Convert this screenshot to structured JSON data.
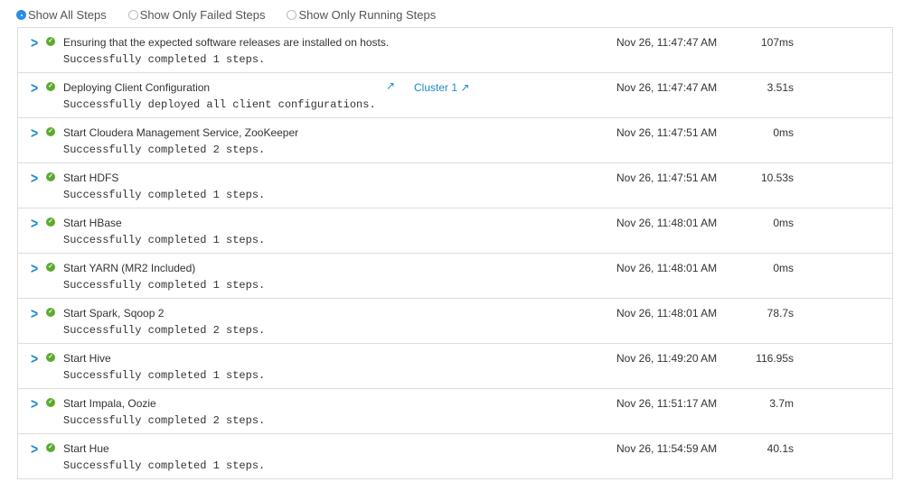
{
  "filters": [
    {
      "label": "Show All Steps",
      "selected": true
    },
    {
      "label": "Show Only Failed Steps",
      "selected": false
    },
    {
      "label": "Show Only Running Steps",
      "selected": false
    }
  ],
  "colors": {
    "accent": "#1a8bd1",
    "success": "#5aab2e"
  },
  "steps": [
    {
      "title": "Ensuring that the expected software releases are installed on hosts.",
      "detail": "Successfully completed 1 steps.",
      "time": "Nov 26, 11:47:47 AM",
      "duration": "107ms"
    },
    {
      "title": "Deploying Client Configuration",
      "detail": "Successfully deployed all client configurations.",
      "time": "Nov 26, 11:47:47 AM",
      "duration": "3.51s",
      "link": "Cluster 1"
    },
    {
      "title": "Start Cloudera Management Service, ZooKeeper",
      "detail": "Successfully completed 2 steps.",
      "time": "Nov 26, 11:47:51 AM",
      "duration": "0ms"
    },
    {
      "title": "Start HDFS",
      "detail": "Successfully completed 1 steps.",
      "time": "Nov 26, 11:47:51 AM",
      "duration": "10.53s"
    },
    {
      "title": "Start HBase",
      "detail": "Successfully completed 1 steps.",
      "time": "Nov 26, 11:48:01 AM",
      "duration": "0ms"
    },
    {
      "title": "Start YARN (MR2 Included)",
      "detail": "Successfully completed 1 steps.",
      "time": "Nov 26, 11:48:01 AM",
      "duration": "0ms"
    },
    {
      "title": "Start Spark, Sqoop 2",
      "detail": "Successfully completed 2 steps.",
      "time": "Nov 26, 11:48:01 AM",
      "duration": "78.7s"
    },
    {
      "title": "Start Hive",
      "detail": "Successfully completed 1 steps.",
      "time": "Nov 26, 11:49:20 AM",
      "duration": "116.95s"
    },
    {
      "title": "Start Impala, Oozie",
      "detail": "Successfully completed 2 steps.",
      "time": "Nov 26, 11:51:17 AM",
      "duration": "3.7m"
    },
    {
      "title": "Start Hue",
      "detail": "Successfully completed 1 steps.",
      "time": "Nov 26, 11:54:59 AM",
      "duration": "40.1s"
    }
  ]
}
